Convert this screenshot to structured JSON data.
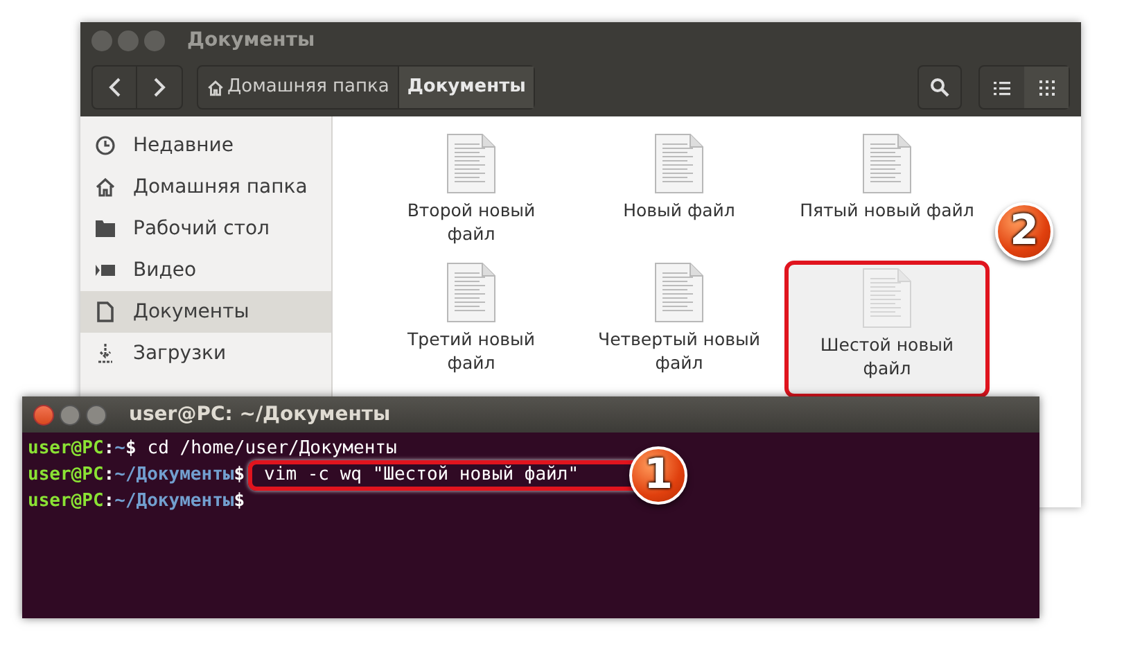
{
  "file_manager": {
    "title": "Документы",
    "path": [
      {
        "label": "Домашняя папка",
        "kind": "home",
        "selected": false
      },
      {
        "label": "Документы",
        "kind": "plain",
        "selected": true
      }
    ],
    "view_buttons": [
      {
        "kind": "list",
        "selected": false
      },
      {
        "kind": "grid",
        "selected": true
      }
    ],
    "sidebar": [
      {
        "label": "Недавние",
        "kind": "recent",
        "selected": false
      },
      {
        "label": "Домашняя папка",
        "kind": "home",
        "selected": false
      },
      {
        "label": "Рабочий стол",
        "kind": "desktop",
        "selected": false
      },
      {
        "label": "Видео",
        "kind": "video",
        "selected": false
      },
      {
        "label": "Документы",
        "kind": "document",
        "selected": true
      },
      {
        "label": "Загрузки",
        "kind": "download",
        "selected": false
      }
    ],
    "files": [
      {
        "name": "Второй новый файл",
        "selected": false
      },
      {
        "name": "Новый файл",
        "selected": false
      },
      {
        "name": "Пятый новый файл",
        "selected": false
      },
      {
        "name": "Третий новый файл",
        "selected": false
      },
      {
        "name": "Четвертый новый файл",
        "selected": false
      },
      {
        "name": "Шестой новый файл",
        "selected": true
      }
    ]
  },
  "terminal": {
    "title": "user@PC: ~/Документы",
    "lines": [
      {
        "prompt": "user@PC",
        "colon": ":",
        "path": "~",
        "dollar": "$",
        "command": "cd /home/user/Документы"
      },
      {
        "prompt": "user@PC",
        "colon": ":",
        "path": "~/Документы",
        "dollar": "$",
        "command": "vim -c wq \"Шестой новый файл\""
      },
      {
        "prompt": "user@PC",
        "colon": ":",
        "path": "~/Документы",
        "dollar": "$"
      }
    ]
  },
  "callouts": [
    {
      "number": "1"
    },
    {
      "number": "2"
    }
  ]
}
